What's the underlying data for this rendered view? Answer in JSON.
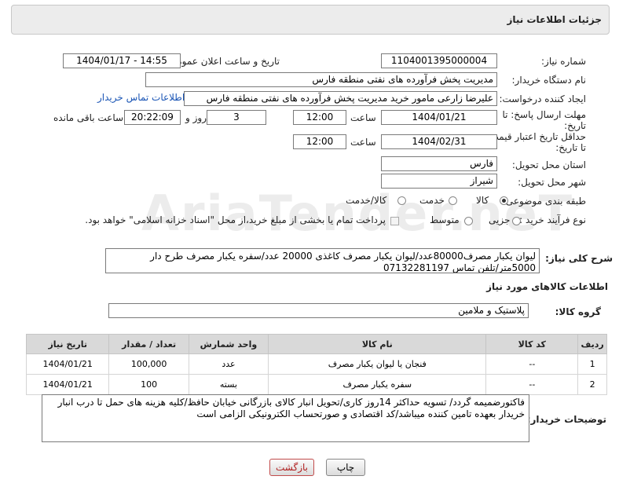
{
  "header": {
    "title": "جزئیات اطلاعات نیاز"
  },
  "fields": {
    "need_number": {
      "label": "شماره نیاز:",
      "value": "1104001395000004"
    },
    "announce_datetime": {
      "label": "تاریخ و ساعت اعلان عمومی:",
      "value": "1404/01/17 - 14:55"
    },
    "buyer_org": {
      "label": "نام دستگاه خریدار:",
      "value": "مدیریت پخش فرآورده های نفتی منطقه فارس"
    },
    "requester": {
      "label": "ایجاد کننده درخواست:",
      "value": "علیرضا زارعی مامور خرید مدیریت پخش فرآورده های نفتی منطقه فارس",
      "contact_link": "اطلاعات تماس خریدار"
    },
    "reply_deadline": {
      "label_line1": "مهلت ارسال پاسخ: تا",
      "label_line2": "تاریخ:",
      "date": "1404/01/21",
      "time_label": "ساعت",
      "time": "12:00",
      "days": "3",
      "days_label": "روز و",
      "remaining": "20:22:09",
      "remaining_label": "ساعت باقی مانده"
    },
    "price_validity": {
      "label_line1": "حداقل تاریخ اعتبار قیمت:",
      "label_line2": "تا تاریخ:",
      "date": "1404/02/31",
      "time_label": "ساعت",
      "time": "12:00"
    },
    "delivery_province": {
      "label": "استان محل تحویل:",
      "value": "فارس"
    },
    "delivery_city": {
      "label": "شهر محل تحویل:",
      "value": "شیراز"
    },
    "category": {
      "label": "طبقه بندی موضوعی:",
      "options": [
        "کالا",
        "خدمت",
        "کالا/خدمت"
      ],
      "selected": "کالا"
    },
    "purchase_type": {
      "label": "نوع فرآیند خرید :",
      "options": [
        "جزیی",
        "متوسط"
      ],
      "selected": "",
      "payment_note": "پرداخت تمام یا بخشی از مبلغ خرید،از محل \"اسناد خزانه اسلامی\" خواهد بود."
    },
    "general_description": {
      "label": "شرح کلی نیاز:",
      "value": "لیوان یکبار مصرف80000عدد/لیوان یکبار مصرف کاغذی 20000 عدد/سفره یکبار مصرف طرح دار 5000متر/تلفن تماس 07132281197"
    }
  },
  "goods_section": {
    "title": "اطلاعات کالاهای مورد نیاز",
    "group_label": "گروه کالا:",
    "group_value": "پلاستیک و ملامین",
    "columns": [
      "ردیف",
      "کد کالا",
      "نام کالا",
      "واحد شمارش",
      "تعداد / مقدار",
      "تاریخ نیاز"
    ],
    "rows": [
      {
        "row": "1",
        "code": "--",
        "name": "فنجان یا لیوان یکبار مصرف",
        "unit": "عدد",
        "qty": "100,000",
        "date": "1404/01/21"
      },
      {
        "row": "2",
        "code": "--",
        "name": "سفره یکبار مصرف",
        "unit": "بسته",
        "qty": "100",
        "date": "1404/01/21"
      }
    ]
  },
  "buyer_notes": {
    "label": "توضیحات خریدار:",
    "value": "فاکتورضمیمه گردد/ تسویه حداکثر 14روز کاری/تحویل انبار کالای بازرگانی خیابان حافظ/کلیه هزینه های حمل تا درب انبار خریدار بعهده تامین کننده میباشد/کد اقتصادی و صورتحساب الکترونیکی الزامی است"
  },
  "buttons": {
    "print": "چاپ",
    "back": "بازگشت"
  },
  "watermark": "AriaTender.neT"
}
